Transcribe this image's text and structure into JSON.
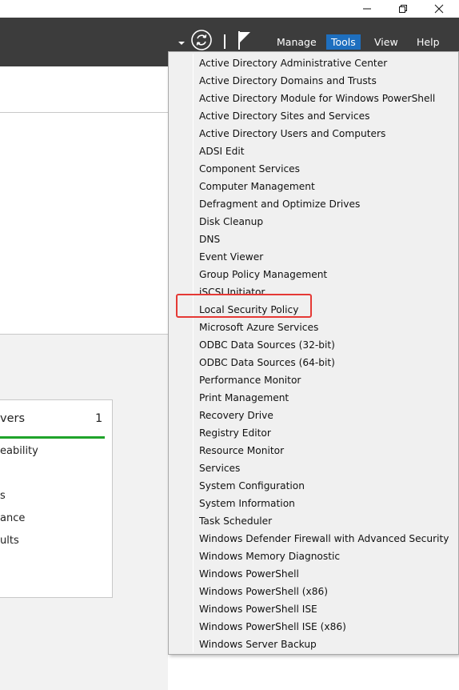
{
  "window_controls": {
    "minimize_icon": "minimize-icon",
    "restore_icon": "restore-icon",
    "close_icon": "close-icon"
  },
  "header": {
    "menu": {
      "manage": "Manage",
      "tools": "Tools",
      "view": "View",
      "help": "Help"
    },
    "icons": [
      "dropdown-arrow-icon",
      "refresh-icon",
      "flag-icon"
    ],
    "active_color": "#1e6fbf",
    "bg_color": "#3c3c3c"
  },
  "tile": {
    "title_fragment": "vers",
    "count": "1",
    "rows": [
      "eability",
      "s",
      "ance",
      "ults"
    ],
    "status_color": "#1fa32a"
  },
  "tools_menu": {
    "items": [
      "Active Directory Administrative Center",
      "Active Directory Domains and Trusts",
      "Active Directory Module for Windows PowerShell",
      "Active Directory Sites and Services",
      "Active Directory Users and Computers",
      "ADSI Edit",
      "Component Services",
      "Computer Management",
      "Defragment and Optimize Drives",
      "Disk Cleanup",
      "DNS",
      "Event Viewer",
      "Group Policy Management",
      "iSCSI Initiator",
      "Local Security Policy",
      "Microsoft Azure Services",
      "ODBC Data Sources (32-bit)",
      "ODBC Data Sources (64-bit)",
      "Performance Monitor",
      "Print Management",
      "Recovery Drive",
      "Registry Editor",
      "Resource Monitor",
      "Services",
      "System Configuration",
      "System Information",
      "Task Scheduler",
      "Windows Defender Firewall with Advanced Security",
      "Windows Memory Diagnostic",
      "Windows PowerShell",
      "Windows PowerShell (x86)",
      "Windows PowerShell ISE",
      "Windows PowerShell ISE (x86)",
      "Windows Server Backup"
    ],
    "highlighted_item": "Local Security Policy",
    "highlight_color": "#e53935"
  }
}
